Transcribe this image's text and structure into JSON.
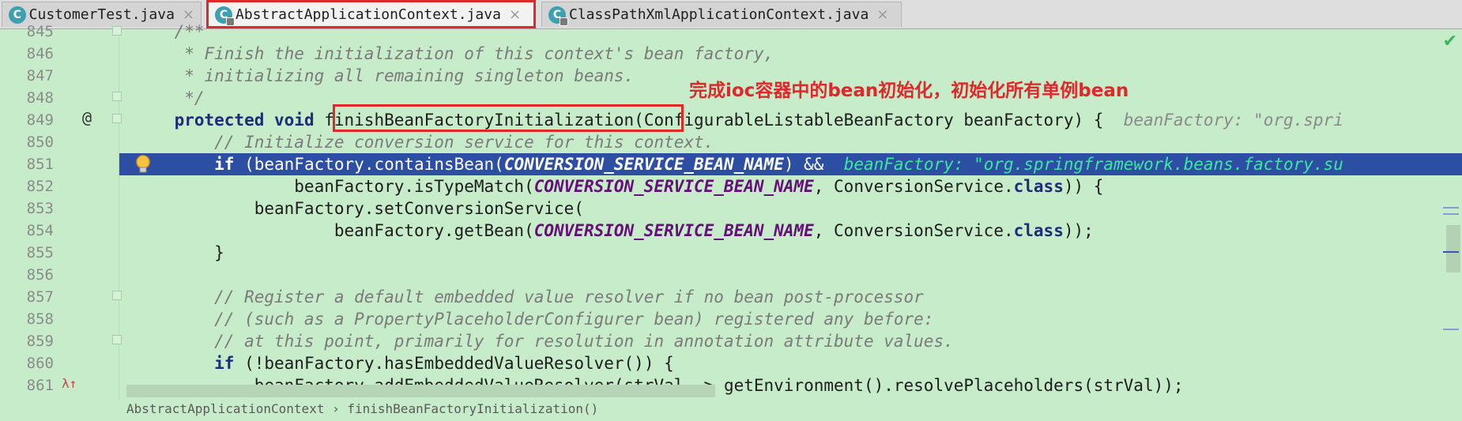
{
  "tabs": [
    {
      "label": "CustomerTest.java",
      "icon": "class-icon",
      "icon_letter": "C"
    },
    {
      "label": "AbstractApplicationContext.java",
      "icon": "abstract-class-icon",
      "icon_letter": "C",
      "active": true
    },
    {
      "label": "ClassPathXmlApplicationContext.java",
      "icon": "class-icon",
      "icon_letter": "C"
    }
  ],
  "close_glyph": "×",
  "lines": [
    {
      "n": "845",
      "parts": [
        {
          "t": "    /**",
          "c": "cm"
        }
      ]
    },
    {
      "n": "846",
      "parts": [
        {
          "t": "     * Finish the initialization of this context's bean factory,",
          "c": "cm"
        }
      ]
    },
    {
      "n": "847",
      "parts": [
        {
          "t": "     * initializing all remaining singleton beans.",
          "c": "cm"
        }
      ]
    },
    {
      "n": "848",
      "parts": [
        {
          "t": "     */",
          "c": "cm"
        }
      ]
    },
    {
      "n": "849",
      "parts": [
        {
          "t": "    ",
          "c": ""
        },
        {
          "t": "protected void",
          "c": "kw"
        },
        {
          "t": " finishBeanFactoryInitialization(ConfigurableListableBeanFactory beanFactory) {  ",
          "c": ""
        },
        {
          "t": "beanFactory: \"org.spri",
          "c": "hint"
        }
      ]
    },
    {
      "n": "850",
      "parts": [
        {
          "t": "        // Initialize conversion service for this context.",
          "c": "cm"
        }
      ]
    },
    {
      "n": "851",
      "parts": [
        {
          "t": "        ",
          "c": ""
        },
        {
          "t": "if",
          "c": "kw"
        },
        {
          "t": " (beanFactory.containsBean(",
          "c": ""
        },
        {
          "t": "CONVERSION_SERVICE_BEAN_NAME",
          "c": "const"
        },
        {
          "t": ") &&  ",
          "c": ""
        },
        {
          "t": "beanFactory: \"org.springframework.beans.factory.su",
          "c": "hint"
        }
      ]
    },
    {
      "n": "852",
      "parts": [
        {
          "t": "                beanFactory.isTypeMatch(",
          "c": ""
        },
        {
          "t": "CONVERSION_SERVICE_BEAN_NAME",
          "c": "const"
        },
        {
          "t": ", ConversionService.",
          "c": ""
        },
        {
          "t": "class",
          "c": "kw"
        },
        {
          "t": ")) {",
          "c": ""
        }
      ]
    },
    {
      "n": "853",
      "parts": [
        {
          "t": "            beanFactory.setConversionService(",
          "c": ""
        }
      ]
    },
    {
      "n": "854",
      "parts": [
        {
          "t": "                    beanFactory.getBean(",
          "c": ""
        },
        {
          "t": "CONVERSION_SERVICE_BEAN_NAME",
          "c": "const"
        },
        {
          "t": ", ConversionService.",
          "c": ""
        },
        {
          "t": "class",
          "c": "kw"
        },
        {
          "t": "));",
          "c": ""
        }
      ]
    },
    {
      "n": "855",
      "parts": [
        {
          "t": "        }",
          "c": ""
        }
      ]
    },
    {
      "n": "856",
      "parts": [
        {
          "t": "",
          "c": ""
        }
      ]
    },
    {
      "n": "857",
      "parts": [
        {
          "t": "        // Register a default embedded value resolver if no bean post-processor",
          "c": "cm"
        }
      ]
    },
    {
      "n": "858",
      "parts": [
        {
          "t": "        // (such as a PropertyPlaceholderConfigurer bean) registered any before:",
          "c": "cm"
        }
      ]
    },
    {
      "n": "859",
      "parts": [
        {
          "t": "        // at this point, primarily for resolution in annotation attribute values.",
          "c": "cm"
        }
      ]
    },
    {
      "n": "860",
      "parts": [
        {
          "t": "        ",
          "c": ""
        },
        {
          "t": "if",
          "c": "kw"
        },
        {
          "t": " (!beanFactory.hasEmbeddedValueResolver()) {",
          "c": ""
        }
      ]
    },
    {
      "n": "861",
      "parts": [
        {
          "t": "            beanFactory.addEmbeddedValueResolver(strVal -> getEnvironment().resolvePlaceholders(strVal));",
          "c": ""
        }
      ]
    }
  ],
  "annotation": "完成ioc容器中的bean初始化，初始化所有单例bean",
  "breadcrumb": {
    "class": "AbstractApplicationContext",
    "sep": "›",
    "method": "finishBeanFactoryInitialization()"
  },
  "gutter_icons": {
    "override": "@",
    "lambda": "λ↑",
    "check": "✔"
  },
  "colors": {
    "editor_bg": "#c7ecc9",
    "selection": "#2c4fa3",
    "highlight_red": "#e0282a"
  }
}
